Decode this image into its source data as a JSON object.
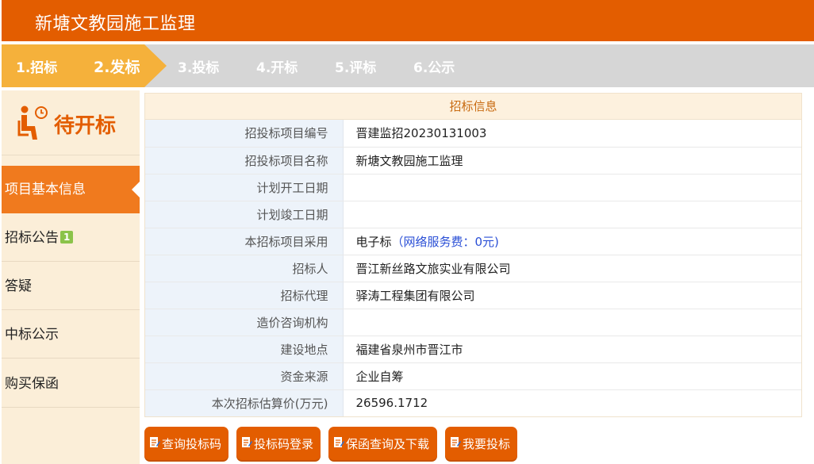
{
  "header": {
    "title": "新塘文教园施工监理"
  },
  "steps": [
    {
      "label": "1.招标",
      "state": "done"
    },
    {
      "label": "2.发标",
      "state": "current"
    },
    {
      "label": "3.投标",
      "state": "pending"
    },
    {
      "label": "4.开标",
      "state": "pending"
    },
    {
      "label": "5.评标",
      "state": "pending"
    },
    {
      "label": "6.公示",
      "state": "pending"
    }
  ],
  "sidebar": {
    "status": "待开标",
    "items": [
      {
        "label": "项目基本信息",
        "active": true
      },
      {
        "label": "招标公告",
        "badge": "1"
      },
      {
        "label": "答疑"
      },
      {
        "label": "中标公示"
      },
      {
        "label": "购买保函"
      }
    ]
  },
  "panel": {
    "title": "招标信息",
    "rows": [
      {
        "label": "招投标项目编号",
        "value": "晋建监招20230131003"
      },
      {
        "label": "招投标项目名称",
        "value": "新塘文教园施工监理"
      },
      {
        "label": "计划开工日期",
        "value": ""
      },
      {
        "label": "计划竣工日期",
        "value": ""
      },
      {
        "label": "本招标项目采用",
        "value": "电子标",
        "note": "（网络服务费：0元)"
      },
      {
        "label": "招标人",
        "value": "晋江新丝路文旅实业有限公司"
      },
      {
        "label": "招标代理",
        "value": "驿涛工程集团有限公司"
      },
      {
        "label": "造价咨询机构",
        "value": ""
      },
      {
        "label": "建设地点",
        "value": "福建省泉州市晋江市"
      },
      {
        "label": "资金来源",
        "value": "企业自筹"
      },
      {
        "label": "本次招标估算价(万元)",
        "value": "26596.1712"
      }
    ]
  },
  "actions": [
    {
      "label": "查询投标码"
    },
    {
      "label": "投标码登录"
    },
    {
      "label": "保函查询及下载"
    },
    {
      "label": "我要投标"
    }
  ],
  "colors": {
    "brand": "#e35d00",
    "step_active": "#f5b13b",
    "step_inactive": "#d6d6d6",
    "sidebar_active": "#f07a1e",
    "link_blue": "#2a4fd6"
  },
  "icons": {
    "status": "person-clock-icon",
    "button": "edit-document-icon"
  }
}
